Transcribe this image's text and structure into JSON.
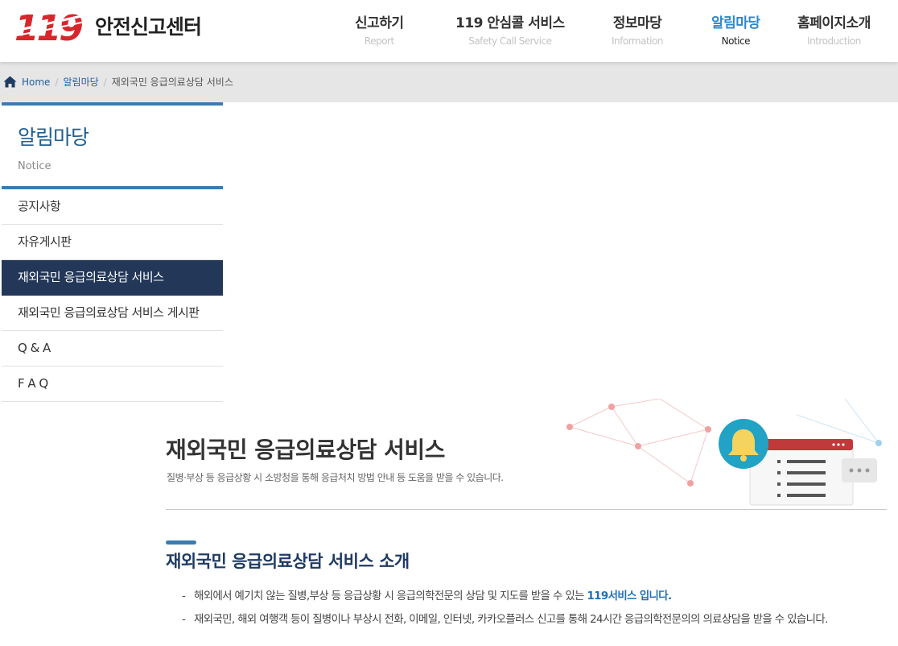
{
  "brand": {
    "logo_text": "119",
    "site_name": "안전신고센터",
    "brand_color": "#d9262b"
  },
  "gnb": [
    {
      "ko": "신고하기",
      "en": "Report",
      "active": false
    },
    {
      "ko": "119 안심콜 서비스",
      "en": "Safety Call Service",
      "active": false
    },
    {
      "ko": "정보마당",
      "en": "Information",
      "active": false
    },
    {
      "ko": "알림마당",
      "en": "Notice",
      "active": true
    },
    {
      "ko": "홈페이지소개",
      "en": "Introduction",
      "active": false
    }
  ],
  "breadcrumb": {
    "icon": "home-icon",
    "home": "Home",
    "section": "알림마당",
    "current": "재외국민 응급의료상담 서비스"
  },
  "sidebar": {
    "title": "알림마당",
    "subtitle": "Notice",
    "items": [
      {
        "label": "공지사항",
        "active": false
      },
      {
        "label": "자유게시판",
        "active": false
      },
      {
        "label": "재외국민 응급의료상담 서비스",
        "active": true
      },
      {
        "label": "재외국민 응급의료상담 서비스 게시판",
        "active": false
      },
      {
        "label": "Q & A",
        "active": false
      },
      {
        "label": "F A Q",
        "active": false
      }
    ]
  },
  "main": {
    "title": "재외국민 응급의료상담 서비스",
    "description": "질병·부상 등 응급상황 시 소방청을 통해 응급처치 방법 안내 등 도움을 받을 수 있습니다.",
    "section_title": "재외국민 응급의료상담 서비스 소개",
    "bullets": [
      {
        "dash": "-",
        "text": "해외에서 예기치 않는 질병,부상 등 응급상황 시 응급의학전문의 상담 및 지도를 받을 수 있는 ",
        "highlight": "119서비스 입니다."
      },
      {
        "dash": "-",
        "text": "재외국민, 해외 여행객 등이 질병이나 부상시 전화, 이메일, 인터넷, 카카오플러스 신고를 통해 24시간 응급의학전문의의 의료상담을 받을 수 있습니다.",
        "highlight": ""
      }
    ]
  },
  "colors": {
    "accent": "#2f87c9",
    "sidebar_active_bg": "#233759",
    "sidebar_line": "#3a7cb1",
    "crumb_bg": "#e6e6e6",
    "highlight_text": "#1f6fb8"
  }
}
